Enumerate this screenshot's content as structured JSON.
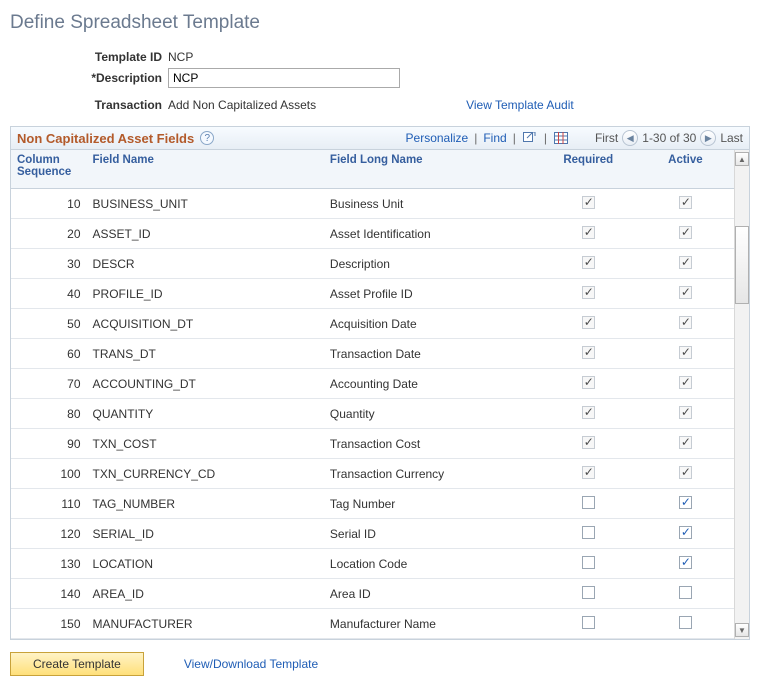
{
  "page": {
    "title": "Define Spreadsheet Template"
  },
  "form": {
    "template_id_label": "Template ID",
    "template_id": "NCP",
    "description_label": "*Description",
    "description": "NCP",
    "transaction_label": "Transaction",
    "transaction": "Add Non Capitalized Assets",
    "view_audit": "View Template Audit"
  },
  "grid": {
    "title": "Non Capitalized Asset Fields",
    "personalize": "Personalize",
    "find": "Find",
    "first": "First",
    "range": "1-30 of 30",
    "last": "Last",
    "headers": {
      "seq": "Column Sequence",
      "fname": "Field Name",
      "lname": "Field Long Name",
      "required": "Required",
      "active": "Active"
    },
    "rows": [
      {
        "seq": 10,
        "fname": "BUSINESS_UNIT",
        "lname": "Business Unit",
        "required": true,
        "required_disabled": true,
        "active": true,
        "active_disabled": true
      },
      {
        "seq": 20,
        "fname": "ASSET_ID",
        "lname": "Asset Identification",
        "required": true,
        "required_disabled": true,
        "active": true,
        "active_disabled": true
      },
      {
        "seq": 30,
        "fname": "DESCR",
        "lname": "Description",
        "required": true,
        "required_disabled": true,
        "active": true,
        "active_disabled": true
      },
      {
        "seq": 40,
        "fname": "PROFILE_ID",
        "lname": "Asset Profile ID",
        "required": true,
        "required_disabled": true,
        "active": true,
        "active_disabled": true
      },
      {
        "seq": 50,
        "fname": "ACQUISITION_DT",
        "lname": "Acquisition Date",
        "required": true,
        "required_disabled": true,
        "active": true,
        "active_disabled": true
      },
      {
        "seq": 60,
        "fname": "TRANS_DT",
        "lname": "Transaction Date",
        "required": true,
        "required_disabled": true,
        "active": true,
        "active_disabled": true
      },
      {
        "seq": 70,
        "fname": "ACCOUNTING_DT",
        "lname": "Accounting Date",
        "required": true,
        "required_disabled": true,
        "active": true,
        "active_disabled": true
      },
      {
        "seq": 80,
        "fname": "QUANTITY",
        "lname": "Quantity",
        "required": true,
        "required_disabled": true,
        "active": true,
        "active_disabled": true
      },
      {
        "seq": 90,
        "fname": "TXN_COST",
        "lname": "Transaction Cost",
        "required": true,
        "required_disabled": true,
        "active": true,
        "active_disabled": true
      },
      {
        "seq": 100,
        "fname": "TXN_CURRENCY_CD",
        "lname": "Transaction Currency",
        "required": true,
        "required_disabled": true,
        "active": true,
        "active_disabled": true
      },
      {
        "seq": 110,
        "fname": "TAG_NUMBER",
        "lname": "Tag Number",
        "required": false,
        "required_disabled": false,
        "active": true,
        "active_disabled": false
      },
      {
        "seq": 120,
        "fname": "SERIAL_ID",
        "lname": "Serial ID",
        "required": false,
        "required_disabled": false,
        "active": true,
        "active_disabled": false
      },
      {
        "seq": 130,
        "fname": "LOCATION",
        "lname": "Location Code",
        "required": false,
        "required_disabled": false,
        "active": true,
        "active_disabled": false
      },
      {
        "seq": 140,
        "fname": "AREA_ID",
        "lname": "Area ID",
        "required": false,
        "required_disabled": false,
        "active": false,
        "active_disabled": false
      },
      {
        "seq": 150,
        "fname": "MANUFACTURER",
        "lname": "Manufacturer Name",
        "required": false,
        "required_disabled": false,
        "active": false,
        "active_disabled": false
      }
    ]
  },
  "footer": {
    "create": "Create Template",
    "view_download": "View/Download Template"
  },
  "icons": {
    "help": "?",
    "popout": "popout-icon",
    "grid": "grid-icon",
    "prev": "◀",
    "next": "▶"
  }
}
